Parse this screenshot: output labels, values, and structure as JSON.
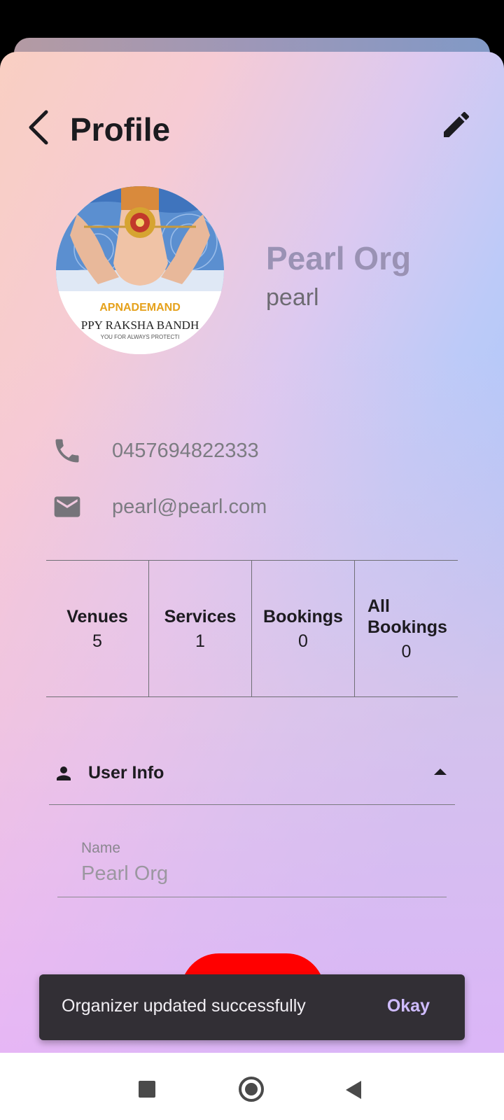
{
  "header": {
    "title": "Profile"
  },
  "profile": {
    "name": "Pearl Org",
    "username": "pearl",
    "avatar_text": {
      "brand": "APNADEMAND",
      "greeting": "PPY RAKSHA BANDH",
      "tagline": "YOU FOR ALWAYS PROTECTI"
    },
    "phone": "0457694822333",
    "email": "pearl@pearl.com"
  },
  "stats": [
    {
      "label": "Venues",
      "value": "5"
    },
    {
      "label": "Services",
      "value": "1"
    },
    {
      "label": "Bookings",
      "value": "0"
    },
    {
      "label": "All\nBookings",
      "value": "0"
    }
  ],
  "user_info": {
    "title": "User Info",
    "fields": {
      "name": {
        "label": "Name",
        "value": "Pearl Org"
      }
    }
  },
  "snackbar": {
    "message": "Organizer updated successfully",
    "action": "Okay"
  },
  "icons": [
    "back-arrow-icon",
    "edit-pencil-icon",
    "phone-icon",
    "email-icon",
    "person-icon",
    "caret-up-icon"
  ],
  "colors": {
    "primary_button": "#ff0000",
    "snackbar_bg": "#322f35",
    "snackbar_action": "#cfbcff"
  }
}
